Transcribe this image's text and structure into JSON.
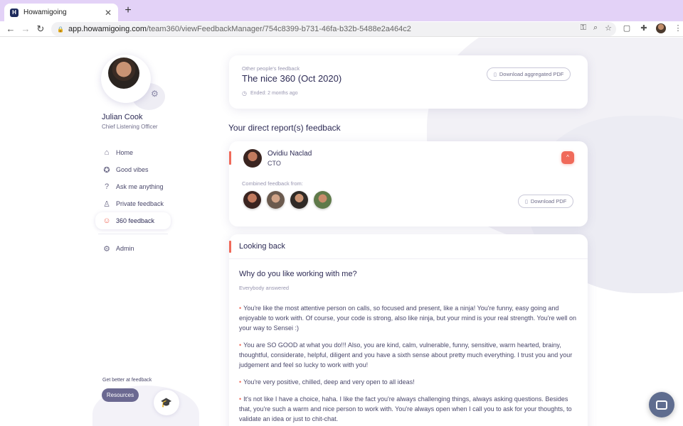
{
  "browser": {
    "tab_title": "Howamigoing",
    "tab_favicon": "H",
    "tab_close": "✕",
    "new_tab": "+",
    "url_host": "app.howamigoing.com",
    "url_path": "/team360/viewFeedbackManager/754c8399-b731-46fa-b32b-5488e2a464c2"
  },
  "profile": {
    "name": "Julian Cook",
    "role": "Chief Listening Officer"
  },
  "sidebar": {
    "items": [
      {
        "label": "Home",
        "icon": "home-icon",
        "glyph": "⌂"
      },
      {
        "label": "Good vibes",
        "icon": "badge-icon",
        "glyph": "✪"
      },
      {
        "label": "Ask me anything",
        "icon": "question-icon",
        "glyph": "?"
      },
      {
        "label": "Private feedback",
        "icon": "user-icon",
        "glyph": "♙"
      },
      {
        "label": "360 feedback",
        "icon": "team-icon",
        "glyph": "☺",
        "active": true
      }
    ],
    "admin": {
      "label": "Admin",
      "icon": "gear-icon",
      "glyph": "⚙"
    },
    "get_better": "Get better at feedback",
    "resources_label": "Resources"
  },
  "header": {
    "kicker": "Other people's feedback",
    "title": "The nice 360 (Oct 2020)",
    "ended": "Ended: 2 months ago",
    "download_label": "Download aggregated PDF"
  },
  "direct_reports": {
    "section_title": "Your direct report(s) feedback",
    "person": {
      "name": "Ovidiu Naclad",
      "role": "CTO"
    },
    "combined_label": "Combined feedback from:",
    "download_label": "Download PDF"
  },
  "looking_back": {
    "title": "Looking back",
    "question": "Why do you like working with me?",
    "answered": "Everybody answered",
    "answers": [
      "You're like the most attentive person on calls, so focused and present, like a ninja!  You're funny, easy going and enjoyable to work with.  Of course, your code is strong, also like ninja, but your mind is your real strength.  You're well on your way to Sensei :)",
      "You are SO GOOD at what you do!!! Also, you are kind, calm, vulnerable, funny, sensitive, warm hearted, brainy, thoughtful, considerate, helpful, diligent and you have a sixth sense about pretty much everything. I trust you and your judgement and feel so lucky to work with you!",
      "You're very positive, chilled, deep and very open to all ideas!",
      "It's not like I have a choice, haha. I like the fact you're always challenging things, always asking questions. Besides that, you're such a warm and nice person to work with. You're always open when I call you to ask for your thoughts, to validate an idea or just to chit-chat."
    ]
  },
  "colors": {
    "accent": "#f06a5a",
    "primary_text": "#2d2b55",
    "tab_bar": "#e3d2f7",
    "resources_button": "#6b6991",
    "chat_button": "#5f6d8f"
  }
}
